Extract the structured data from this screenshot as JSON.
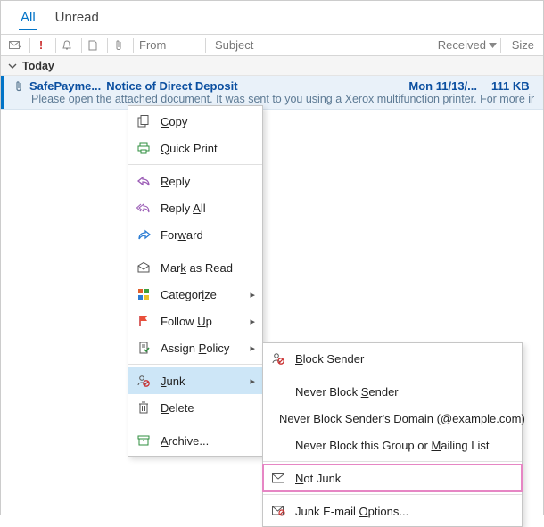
{
  "tabs": {
    "all": "All",
    "unread": "Unread"
  },
  "columns": {
    "from": "From",
    "subject": "Subject",
    "received": "Received",
    "size": "Size"
  },
  "group": {
    "today": "Today"
  },
  "message": {
    "from": "SafePayme...",
    "subject": "Notice of Direct Deposit",
    "date": "Mon 11/13/...",
    "size": "111 KB",
    "preview": "Please open the attached document. It was sent to you using a Xerox multifunction printer. For more inf"
  },
  "context_menu": {
    "copy": "Copy",
    "quick_print": "Quick Print",
    "reply": "Reply",
    "reply_all": "Reply All",
    "forward": "Forward",
    "mark_as_read": "Mark as Read",
    "categorize": "Categorize",
    "follow_up": "Follow Up",
    "assign_policy": "Assign Policy",
    "junk": "Junk",
    "delete": "Delete",
    "archive": "Archive..."
  },
  "junk_submenu": {
    "block_sender": "Block Sender",
    "never_block_sender": "Never Block Sender",
    "never_block_domain": "Never Block Sender's Domain (@example.com)",
    "never_block_group": "Never Block this Group or Mailing List",
    "not_junk": "Not Junk",
    "options": "Junk E-mail Options..."
  }
}
